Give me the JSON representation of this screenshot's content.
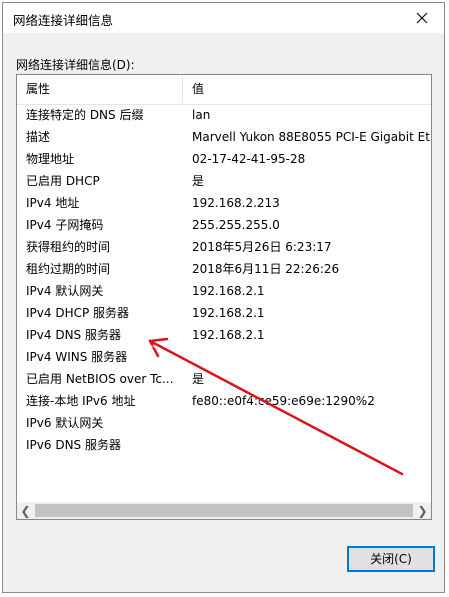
{
  "window": {
    "title": "网络连接详细信息"
  },
  "group_label": "网络连接详细信息(D):",
  "table": {
    "headers": {
      "property": "属性",
      "value": "值"
    },
    "rows": [
      {
        "property": "连接特定的 DNS 后缀",
        "value": "lan"
      },
      {
        "property": "描述",
        "value": "Marvell Yukon 88E8055 PCI-E Gigabit Et"
      },
      {
        "property": "物理地址",
        "value": "02-17-42-41-95-28"
      },
      {
        "property": "已启用 DHCP",
        "value": "是"
      },
      {
        "property": "IPv4 地址",
        "value": "192.168.2.213"
      },
      {
        "property": "IPv4 子网掩码",
        "value": "255.255.255.0"
      },
      {
        "property": "获得租约的时间",
        "value": "2018年5月26日 6:23:17"
      },
      {
        "property": "租约过期的时间",
        "value": "2018年6月11日 22:26:26"
      },
      {
        "property": "IPv4 默认网关",
        "value": "192.168.2.1"
      },
      {
        "property": "IPv4 DHCP 服务器",
        "value": "192.168.2.1"
      },
      {
        "property": "IPv4 DNS 服务器",
        "value": "192.168.2.1"
      },
      {
        "property": "IPv4 WINS 服务器",
        "value": ""
      },
      {
        "property": "已启用 NetBIOS over Tc...",
        "value": "是"
      },
      {
        "property": "连接-本地 IPv6 地址",
        "value": "fe80::e0f4:ce59:e69e:1290%2"
      },
      {
        "property": "IPv6 默认网关",
        "value": ""
      },
      {
        "property": "IPv6 DNS 服务器",
        "value": ""
      }
    ]
  },
  "buttons": {
    "close": "关闭(C)"
  },
  "icons": {
    "close": "close-icon",
    "scroll_left": "chevron-left-icon",
    "scroll_right": "chevron-right-icon"
  },
  "colors": {
    "annotation_arrow": "#d9151b",
    "focus_border": "#0078d7"
  }
}
